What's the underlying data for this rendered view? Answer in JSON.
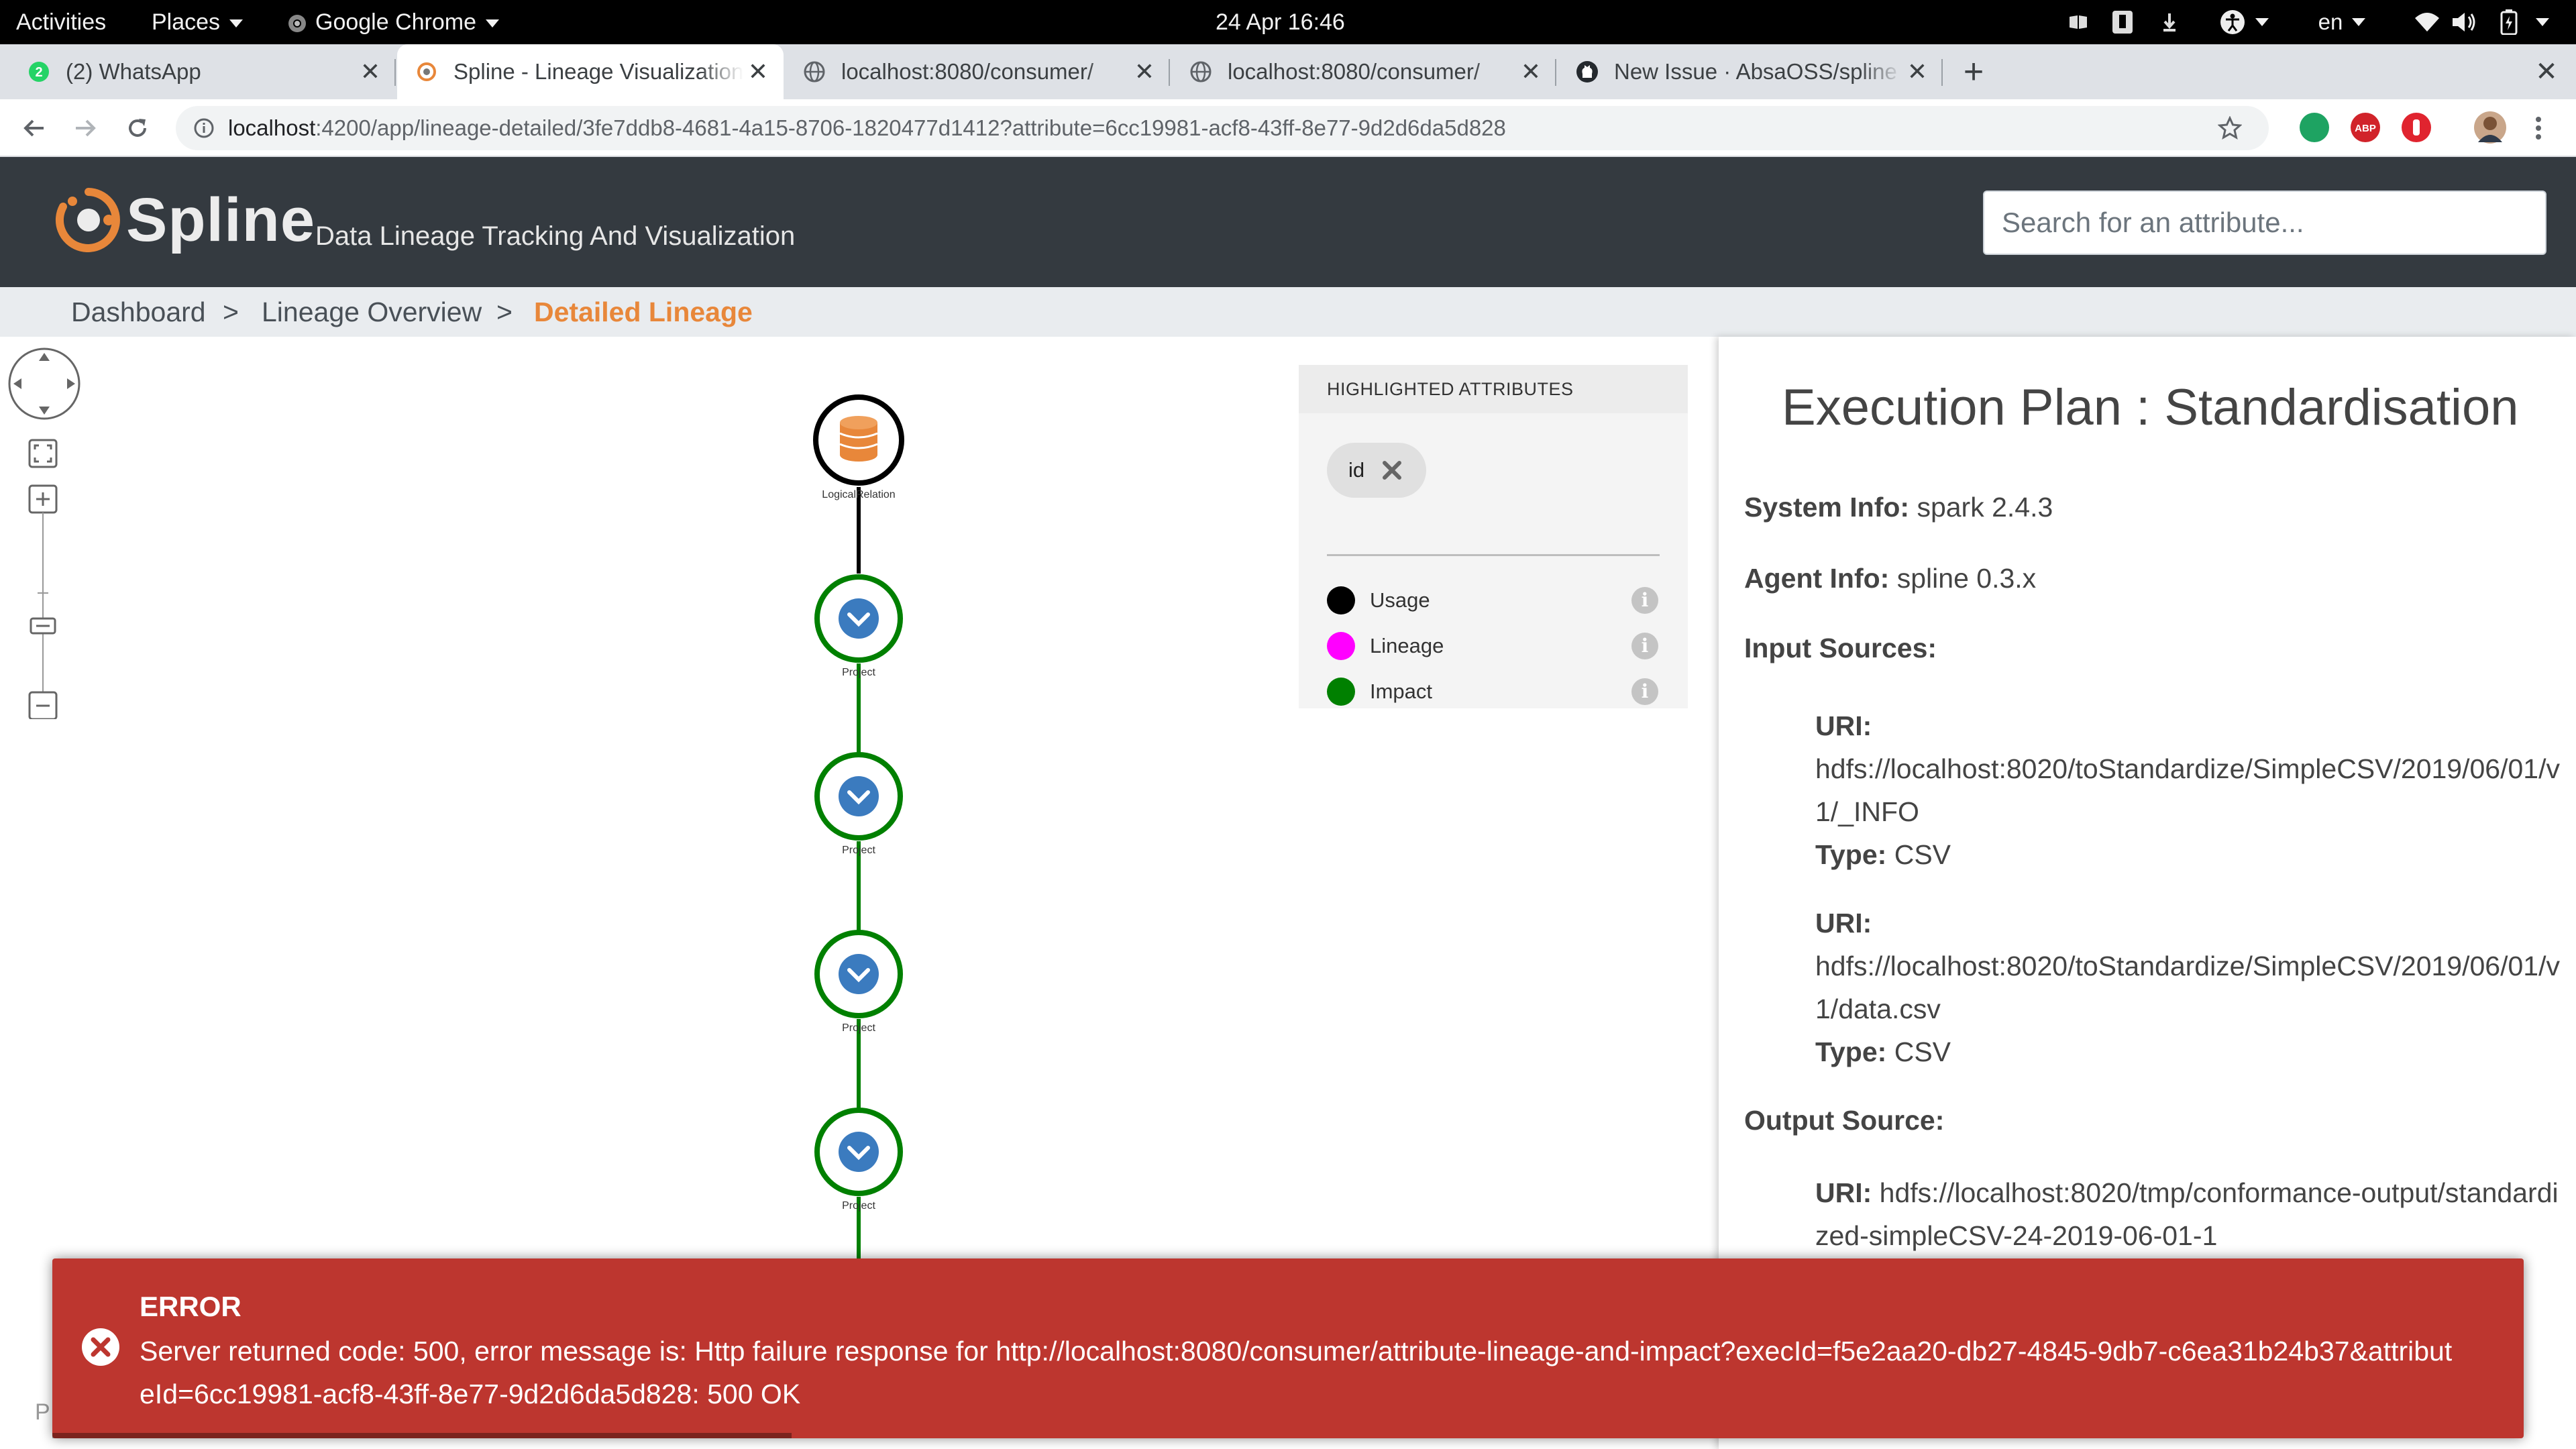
{
  "os": {
    "activities": "Activities",
    "places": "Places",
    "app_menu": "Google Chrome",
    "clock": "24 Apr  16:46",
    "lang": "en"
  },
  "browser": {
    "tabs": [
      {
        "title": "(2) WhatsApp",
        "icon": "whatsapp-icon"
      },
      {
        "title": "Spline - Lineage Visualization",
        "icon": "spline-icon"
      },
      {
        "title": "localhost:8080/consumer/",
        "icon": "globe-icon"
      },
      {
        "title": "localhost:8080/consumer/",
        "icon": "globe-icon"
      },
      {
        "title": "New Issue · AbsaOSS/spline",
        "icon": "github-icon"
      }
    ],
    "url_host": "localhost",
    "url_rest": ":4200/app/lineage-detailed/3fe7ddb8-4681-4a15-8706-1820477d1412?attribute=6cc19981-acf8-43ff-8e77-9d2d6da5d828"
  },
  "header": {
    "logo": "Spline",
    "tagline": "Data Lineage Tracking And Visualization",
    "search_placeholder": "Search for an attribute..."
  },
  "breadcrumb": {
    "items": [
      "Dashboard",
      "Lineage Overview",
      "Detailed Lineage"
    ],
    "separator": ">"
  },
  "graph": {
    "nodes": [
      {
        "label": "LogicalRelation",
        "kind": "database-icon"
      },
      {
        "label": "Project",
        "kind": "chevron-down-icon"
      },
      {
        "label": "Project",
        "kind": "chevron-down-icon"
      },
      {
        "label": "Project",
        "kind": "chevron-down-icon"
      },
      {
        "label": "Project",
        "kind": "chevron-down-icon"
      }
    ],
    "colors": {
      "usage": "#000000",
      "impact": "#008000",
      "node_fill": "#3b7bbf",
      "db_icon": "#e8873a"
    }
  },
  "legend": {
    "header": "HIGHLIGHTED ATTRIBUTES",
    "chip": "id",
    "items": [
      {
        "label": "Usage",
        "color": "#000000"
      },
      {
        "label": "Lineage",
        "color": "#ff00ff"
      },
      {
        "label": "Impact",
        "color": "#008000"
      }
    ]
  },
  "details": {
    "title": "Execution Plan : Standardisation",
    "system_info_label": "System Info:",
    "system_info": "spark 2.4.3",
    "agent_info_label": "Agent Info:",
    "agent_info": "spline 0.3.x",
    "input_sources_label": "Input Sources:",
    "uri_label": "URI:",
    "type_label": "Type:",
    "inputs": [
      {
        "uri": "hdfs://localhost:8020/toStandardize/SimpleCSV/2019/06/01/v1/_INFO",
        "type": "CSV"
      },
      {
        "uri": "hdfs://localhost:8020/toStandardize/SimpleCSV/2019/06/01/v1/data.csv",
        "type": "CSV"
      }
    ],
    "output_source_label": "Output Source:",
    "output_uri": "hdfs://localhost:8020/tmp/conformance-output/standardized-simpleCSV-24-2019-06-01-1"
  },
  "toast": {
    "title": "ERROR",
    "message": "Server returned code: 500, error message is: Http failure response for http://localhost:8080/consumer/attribute-lineage-and-impact?execId=f5e2aa20-db27-4845-9db7-c6ea31b24b37&attributeId=6cc19981-acf8-43ff-8e77-9d2d6da5d828: 500 OK",
    "color": "#bd362f"
  },
  "footer_hint": "P"
}
